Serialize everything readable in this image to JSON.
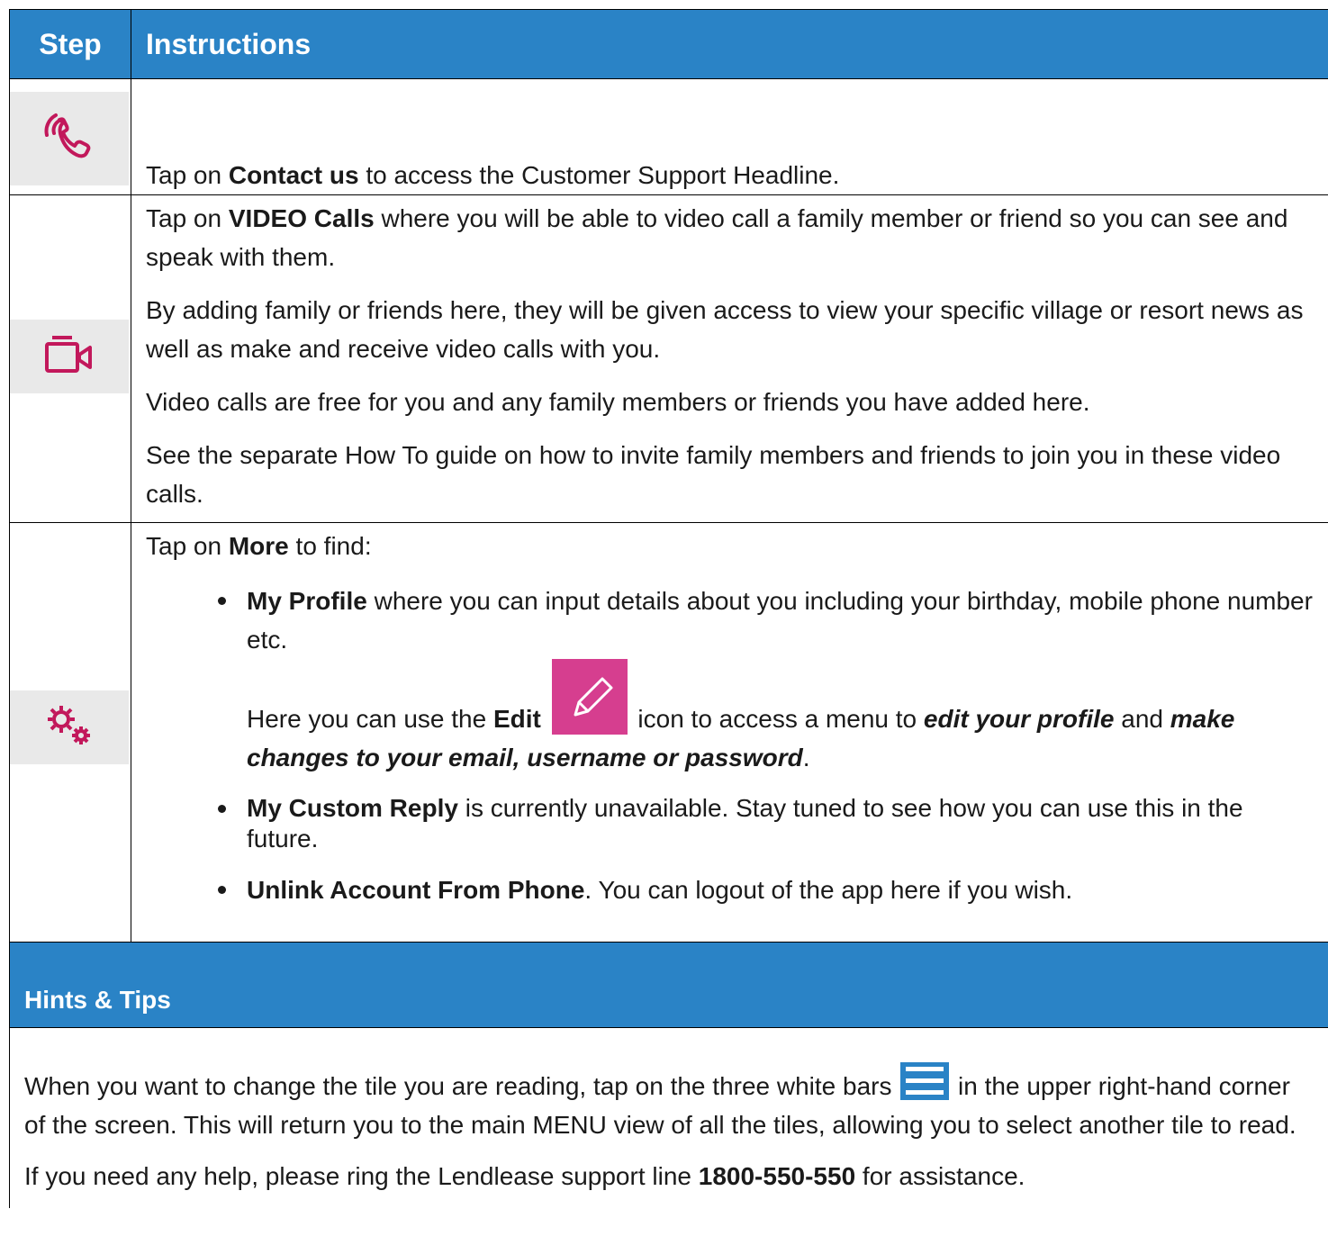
{
  "header": {
    "step": "Step",
    "instructions": "Instructions"
  },
  "rows": {
    "contact": {
      "icon": "phone-icon",
      "pre": "Tap on ",
      "bold": "Contact us",
      "post": " to access the Customer Support Headline."
    },
    "video": {
      "icon": "video-camera-icon",
      "p1_pre": "Tap on ",
      "p1_bold": "VIDEO Calls",
      "p1_post": " where you will be able to video call a family member or friend so you can see and speak with them.",
      "p2": "By adding family or friends here, they will be given access to view your specific village or resort news as well as make and receive video calls with you.",
      "p3": "Video calls are free for you and any family members or friends you have added here.",
      "p4": "See the separate How To guide on how to invite family members and friends to join you in these video calls."
    },
    "more": {
      "icon": "gears-icon",
      "intro_pre": "Tap on ",
      "intro_bold": "More",
      "intro_post": " to find:",
      "b1_bold": "My Profile",
      "b1_text": " where you can input details about you including your birthday, mobile phone number etc.",
      "edit_pre": "Here you can use the ",
      "edit_bold": "Edit",
      "edit_mid": " icon to access a menu to ",
      "edit_em1": "edit your profile",
      "edit_and": " and ",
      "edit_em2": "make changes to your email, username or password",
      "edit_end": ".",
      "b2_bold": "My Custom Reply",
      "b2_text": " is currently unavailable. Stay tuned to see how you can use this in the future.",
      "b3_bold": "Unlink Account From Phone",
      "b3_text": ". You can logout of the app here if you wish."
    }
  },
  "hints": {
    "title": "Hints & Tips",
    "p1_pre": "When you want to change the tile you are reading, tap on the three white bars",
    "p1_post": " in the upper right-hand corner of the screen. This will return you to the main MENU view of all the tiles, allowing you to select another tile to read.",
    "p2_pre": "If you need any help, please ring the Lendlease support line ",
    "p2_bold": "1800-550-550",
    "p2_post": " for assistance."
  },
  "colors": {
    "header_blue": "#2a83c6",
    "accent_pink": "#c2185b",
    "edit_pink": "#d63e8f"
  }
}
